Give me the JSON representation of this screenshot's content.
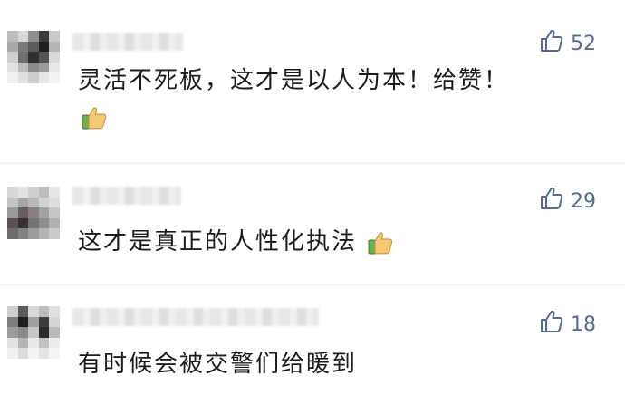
{
  "comments": [
    {
      "text": "灵活不死板，这才是以人为本！给赞！",
      "likes": "52"
    },
    {
      "text": "这才是真正的人性化执法",
      "likes": "29"
    },
    {
      "text": "有时候会被交警们给暖到",
      "likes": "18"
    }
  ],
  "colors": {
    "like_blue": "#576b95",
    "text": "#1c1c1c"
  },
  "icons": {
    "like": "thumbs-up-outline-icon",
    "emoji": "thumbs-up-emoji-icon"
  }
}
